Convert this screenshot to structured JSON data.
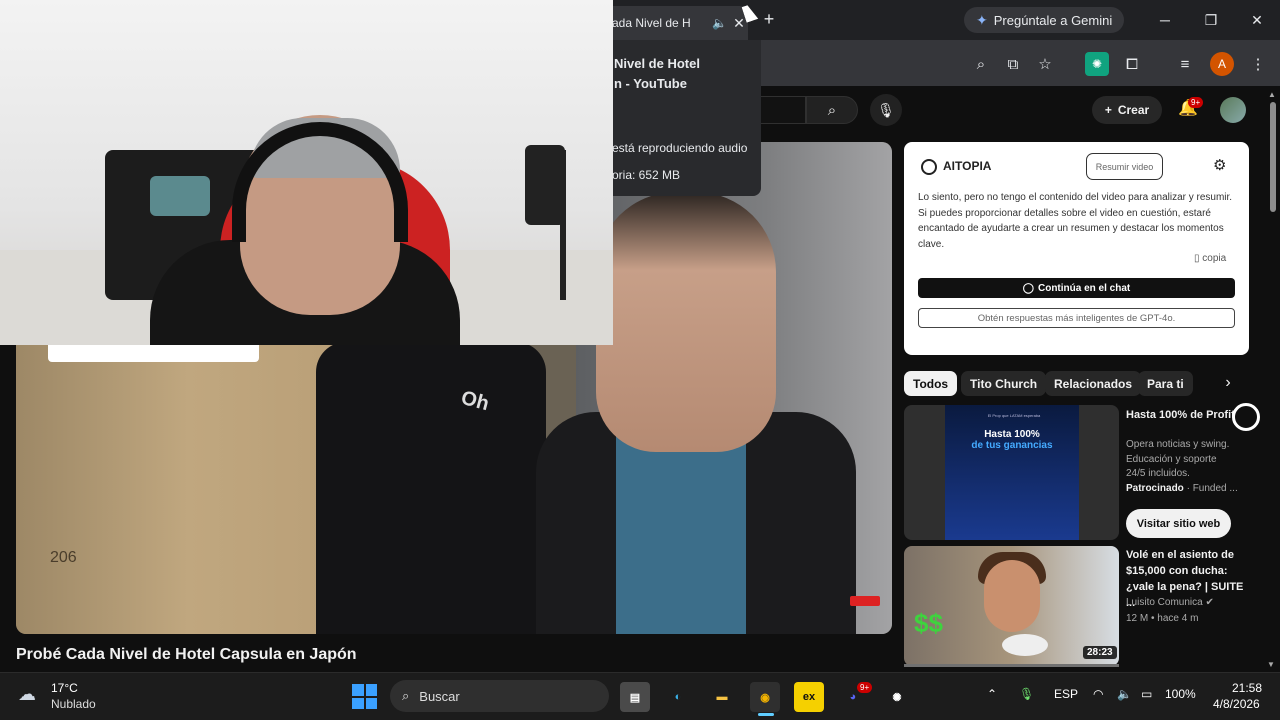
{
  "browser": {
    "tab_title": "ada Nivel de H",
    "new_tab": "+",
    "gemini_label": "Pregúntale a Gemini",
    "window_controls": {
      "minimize": "─",
      "maximize": "❐",
      "close": "✕"
    },
    "profile_letter": "A"
  },
  "hovercard": {
    "title_line1": "Nivel de Hotel",
    "title_line2": "n - YouTube",
    "audio_status": "está reproduciendo audio",
    "memory": "oria: 652 MB"
  },
  "youtube": {
    "create_label": "Crear",
    "notif_count": "9+",
    "video_title": "Probé Cada Nivel de Hotel Capsula en Japón",
    "video_overlay_room": "206",
    "video_overlay_hoodie": "Oh",
    "chips": [
      "Todos",
      "Tito Church",
      "Relacionados",
      "Para ti"
    ]
  },
  "aitopia": {
    "brand": "AITOPIA",
    "summarize_button": "Resumir video",
    "message": "Lo siento, pero no tengo el contenido del video para analizar y resumir. Si puedes proporcionar detalles sobre el video en cuestión, estaré encantado de ayudarte a crear un resumen y destacar los momentos clave.",
    "copy_label": "copia",
    "continue_chat": "Continúa en el chat",
    "gpt_upsell": "Obtén respuestas más inteligentes de GPT-4o."
  },
  "ad": {
    "thumb_small": "El Prop que LATAM esperaba",
    "thumb_headline_a": "Hasta 100%",
    "thumb_headline_b": "de tus ganancias",
    "title": "Hasta 100% de Profit",
    "description": "Opera noticias y swing. Educación y soporte 24/5 incluidos.",
    "sponsored": "Patrocinado",
    "advertiser": "Funded ...",
    "cta": "Visitar sitio web"
  },
  "recommendation": {
    "title": "Volé en el asiento de $15,000 con ducha: ¿vale la pena? | SUITE ...",
    "channel": "Luisito Comunica",
    "views": "12 M",
    "age": "hace 4 m",
    "duration": "28:23"
  },
  "taskbar": {
    "temperature": "17°C",
    "condition": "Nublado",
    "search_placeholder": "Buscar",
    "language": "ESP",
    "battery": "100%",
    "time": "21:58",
    "date": "4/8/2026",
    "discord_badge": "9+"
  },
  "colors": {
    "youtube_bg": "#0f0f0f",
    "chrome_bar": "#202124",
    "accent_blue": "#3aa0ff",
    "badge_red": "#cc0000"
  }
}
